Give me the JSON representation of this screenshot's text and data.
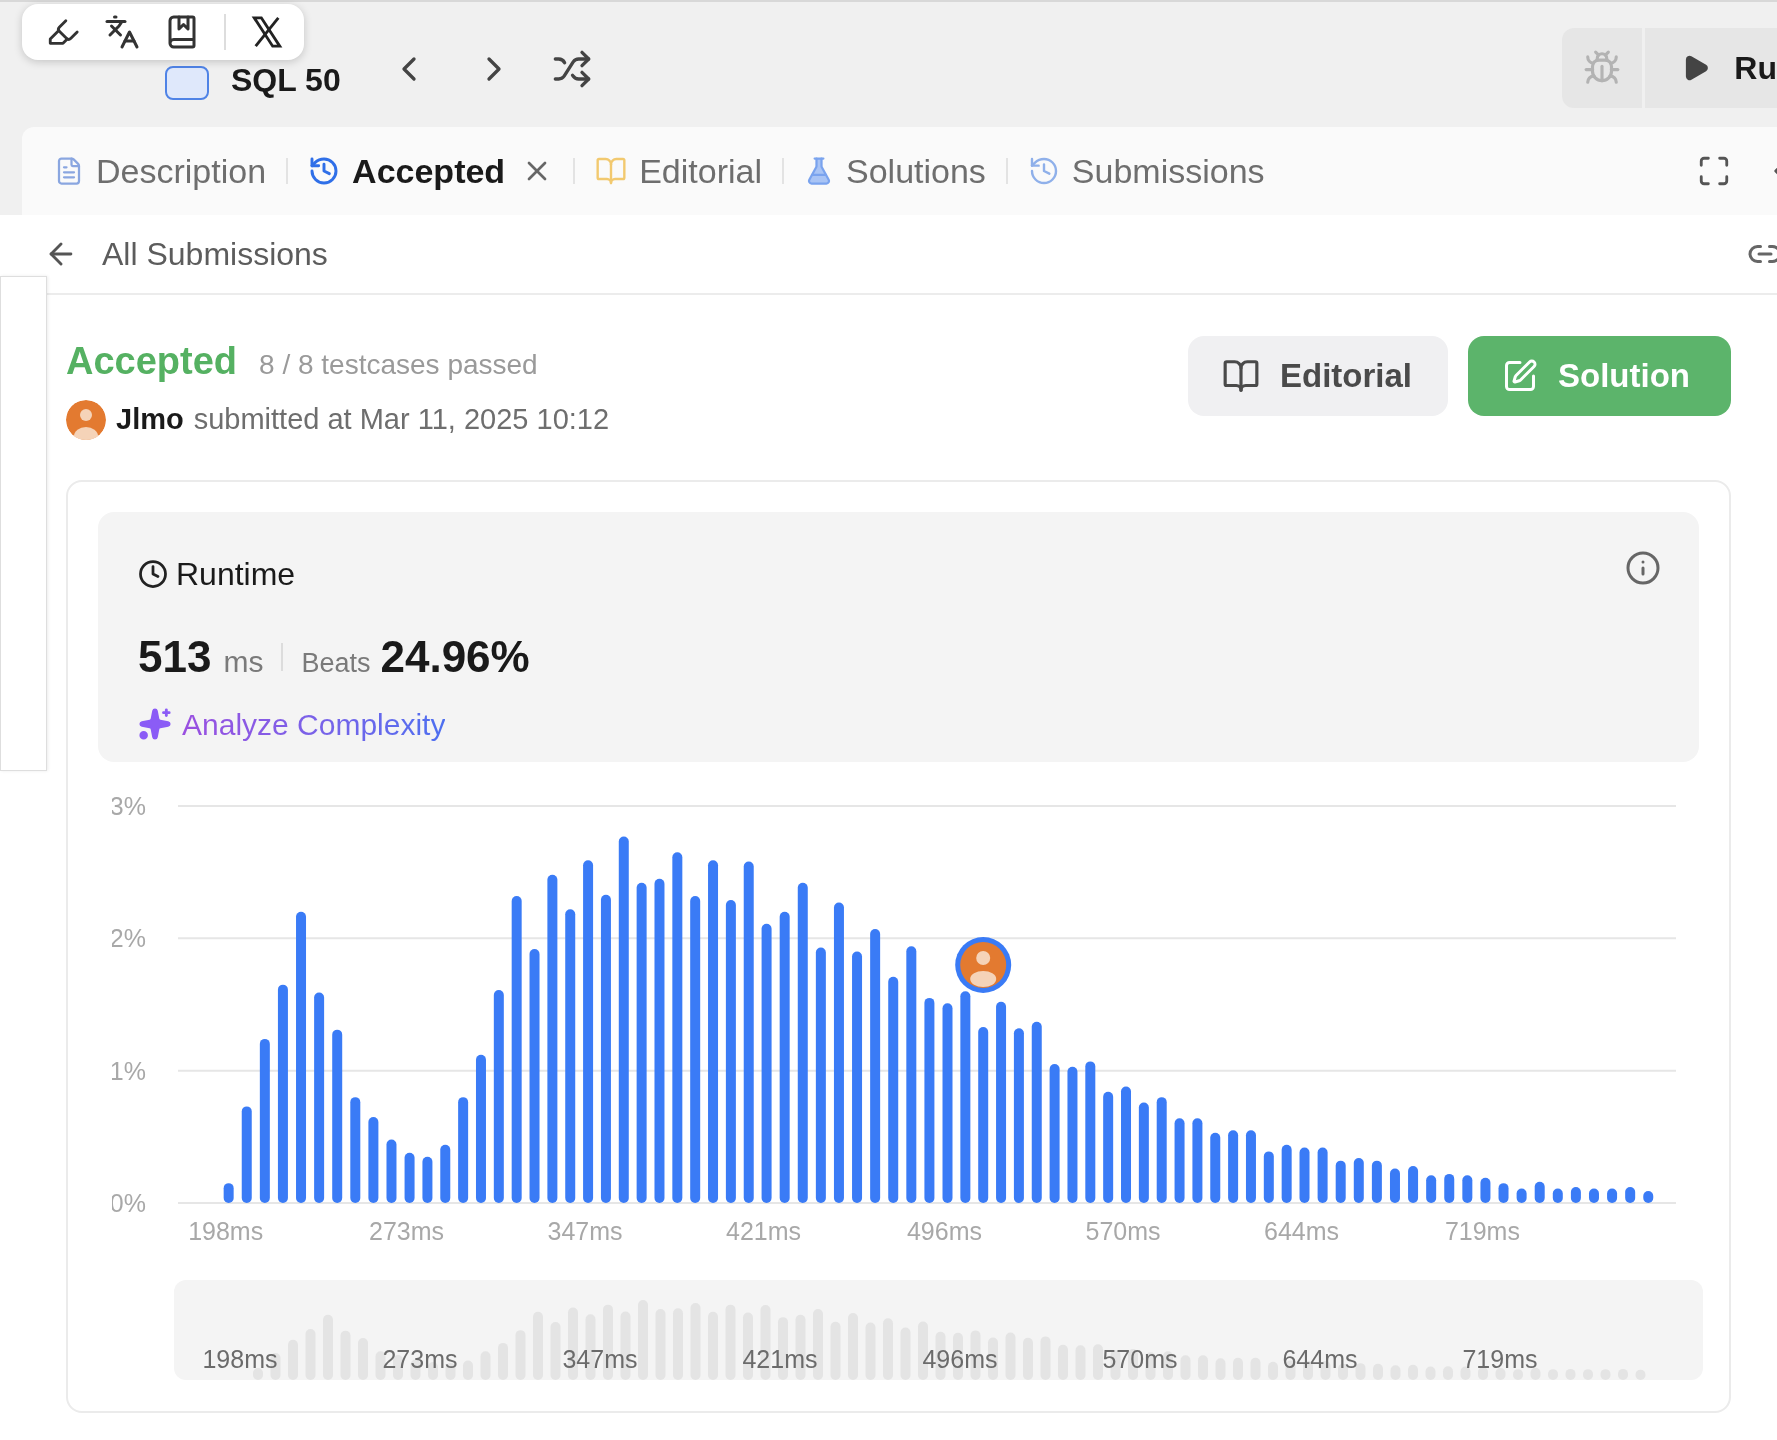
{
  "top_bar": {
    "title": "SQL 50",
    "run_label": "Ru"
  },
  "tabs": [
    {
      "label": "Description",
      "kind": "description",
      "selected": false,
      "closable": false
    },
    {
      "label": "Accepted",
      "kind": "result",
      "selected": true,
      "closable": true
    },
    {
      "label": "Editorial",
      "kind": "editorial",
      "selected": false,
      "closable": false
    },
    {
      "label": "Solutions",
      "kind": "solutions",
      "selected": false,
      "closable": false
    },
    {
      "label": "Submissions",
      "kind": "submissions",
      "selected": false,
      "closable": false
    }
  ],
  "back_link": "All Submissions",
  "submission": {
    "status": "Accepted",
    "testcases": "8 / 8 testcases passed",
    "user": "Jlmo",
    "submitted": "submitted at Mar 11, 2025 10:12"
  },
  "actions": [
    {
      "label": "Editorial",
      "kind": "secondary"
    },
    {
      "label": "Solution",
      "kind": "primary"
    }
  ],
  "runtime": {
    "title": "Runtime",
    "value": "513",
    "unit": "ms",
    "beats_label": "Beats",
    "beats": "24.96%",
    "analyze": "Analyze Complexity",
    "chart_data": {
      "type": "bar",
      "ylim": [
        0,
        3
      ],
      "xlim": [
        177,
        798
      ],
      "x": [
        198,
        205.5,
        213,
        220.5,
        228,
        235.5,
        243,
        250.5,
        258,
        265.5,
        273,
        280.4,
        287.8,
        295.2,
        302.6,
        310,
        317.4,
        324.8,
        332.2,
        339.6,
        347,
        354.4,
        361.8,
        369.2,
        376.6,
        384,
        391.4,
        398.8,
        406.2,
        413.6,
        421,
        428.5,
        436,
        443.5,
        451,
        458.5,
        466,
        473.5,
        481,
        488.5,
        496,
        503.4,
        510.8,
        518.2,
        525.6,
        533,
        540.4,
        547.8,
        555.2,
        562.6,
        570,
        577.4,
        584.8,
        592.2,
        599.6,
        607,
        614.4,
        621.8,
        629.2,
        636.6,
        644,
        651.5,
        659,
        666.5,
        674,
        681.5,
        689,
        696.5,
        704,
        711.5,
        719,
        726.5,
        734,
        741.5,
        749,
        756.5,
        764,
        771.5,
        779,
        786.5
      ],
      "yticks": [
        {
          "value": 0,
          "label": "0%"
        },
        {
          "value": 1,
          "label": "1%"
        },
        {
          "value": 2,
          "label": "2%"
        },
        {
          "value": 3,
          "label": "3%"
        }
      ],
      "xticks": [
        {
          "value": 198,
          "label": "198ms"
        },
        {
          "value": 273,
          "label": "273ms"
        },
        {
          "value": 347,
          "label": "347ms"
        },
        {
          "value": 421,
          "label": "421ms"
        },
        {
          "value": 496,
          "label": "496ms"
        },
        {
          "value": 570,
          "label": "570ms"
        },
        {
          "value": 644,
          "label": "644ms"
        },
        {
          "value": 719,
          "label": "719ms"
        }
      ],
      "series": [
        {
          "color": "#3a7bf6",
          "values": [
            0.15,
            0.73,
            1.24,
            1.65,
            2.2,
            1.59,
            1.31,
            0.8,
            0.65,
            0.48,
            0.38,
            0.35,
            0.44,
            0.8,
            1.12,
            1.61,
            2.32,
            1.92,
            2.48,
            2.22,
            2.59,
            2.33,
            2.77,
            2.42,
            2.45,
            2.65,
            2.32,
            2.59,
            2.29,
            2.58,
            2.11,
            2.2,
            2.42,
            1.93,
            2.27,
            1.9,
            2.07,
            1.71,
            1.94,
            1.55,
            1.51,
            1.6,
            1.33,
            1.52,
            1.32,
            1.37,
            1.05,
            1.03,
            1.07,
            0.84,
            0.88,
            0.76,
            0.8,
            0.64,
            0.64,
            0.53,
            0.55,
            0.55,
            0.39,
            0.44,
            0.42,
            0.42,
            0.32,
            0.34,
            0.32,
            0.26,
            0.28,
            0.21,
            0.22,
            0.21,
            0.19,
            0.15,
            0.11,
            0.16,
            0.11,
            0.12,
            0.11,
            0.11,
            0.12,
            0.09
          ]
        }
      ]
    }
  },
  "navigator": {
    "labels": [
      "198ms",
      "273ms",
      "347ms",
      "421ms",
      "496ms",
      "570ms",
      "644ms",
      "719ms"
    ]
  }
}
